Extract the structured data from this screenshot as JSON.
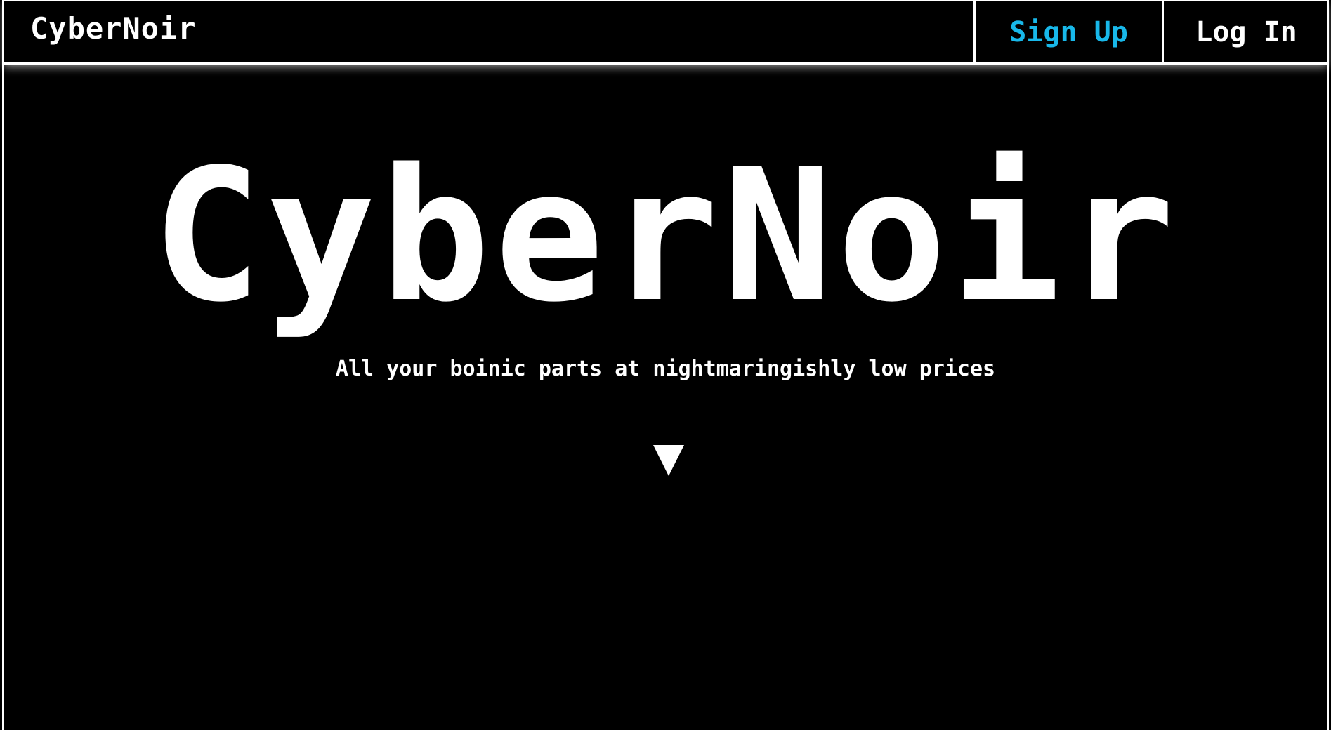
{
  "navbar": {
    "brand": "CyberNoir",
    "signup_label": "Sign Up",
    "login_label": "Log In"
  },
  "hero": {
    "title": "CyberNoir",
    "tagline": "All your boinic parts at nightmaringishly low prices",
    "scroll_icon": "triangle-down-icon"
  },
  "colors": {
    "background": "#000000",
    "text": "#ffffff",
    "accent": "#18b8ea"
  }
}
